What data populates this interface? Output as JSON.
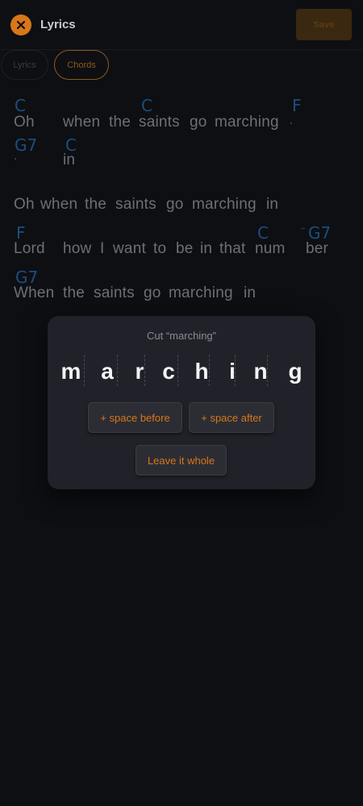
{
  "header": {
    "title": "Lyrics",
    "save_label": "Save"
  },
  "tabs": [
    {
      "label": "Lyrics",
      "active": false
    },
    {
      "label": "Chords",
      "active": true
    }
  ],
  "colors": {
    "accent": "#d9761a",
    "chord": "#1b4e7e",
    "background": "#0e0f13",
    "modal": "#212229"
  },
  "lyrics": {
    "line1": [
      "Oh",
      "when",
      "the",
      "saints",
      "go",
      "marching"
    ],
    "line1b": [
      "in"
    ],
    "line2": [
      "Oh",
      "when",
      "the",
      "saints",
      "go",
      "marching",
      "in"
    ],
    "line3": [
      "Lord",
      "how",
      "I",
      "want",
      "to",
      "be",
      "in",
      "that",
      "num",
      "ber"
    ],
    "line4": [
      "When",
      "the",
      "saints",
      "go",
      "marching",
      "in"
    ]
  },
  "chords": {
    "line1": [
      "C",
      "C",
      "F"
    ],
    "line1b": [
      "G7",
      "C"
    ],
    "line3": [
      "F",
      "C",
      "G7"
    ],
    "line4": [
      "G7"
    ]
  },
  "modal": {
    "title": "Cut “marching”",
    "letters": [
      "m",
      "a",
      "r",
      "c",
      "h",
      "i",
      "n",
      "g"
    ],
    "space_before_label": "+ space before",
    "space_after_label": "+ space after",
    "leave_whole_label": "Leave it whole"
  }
}
